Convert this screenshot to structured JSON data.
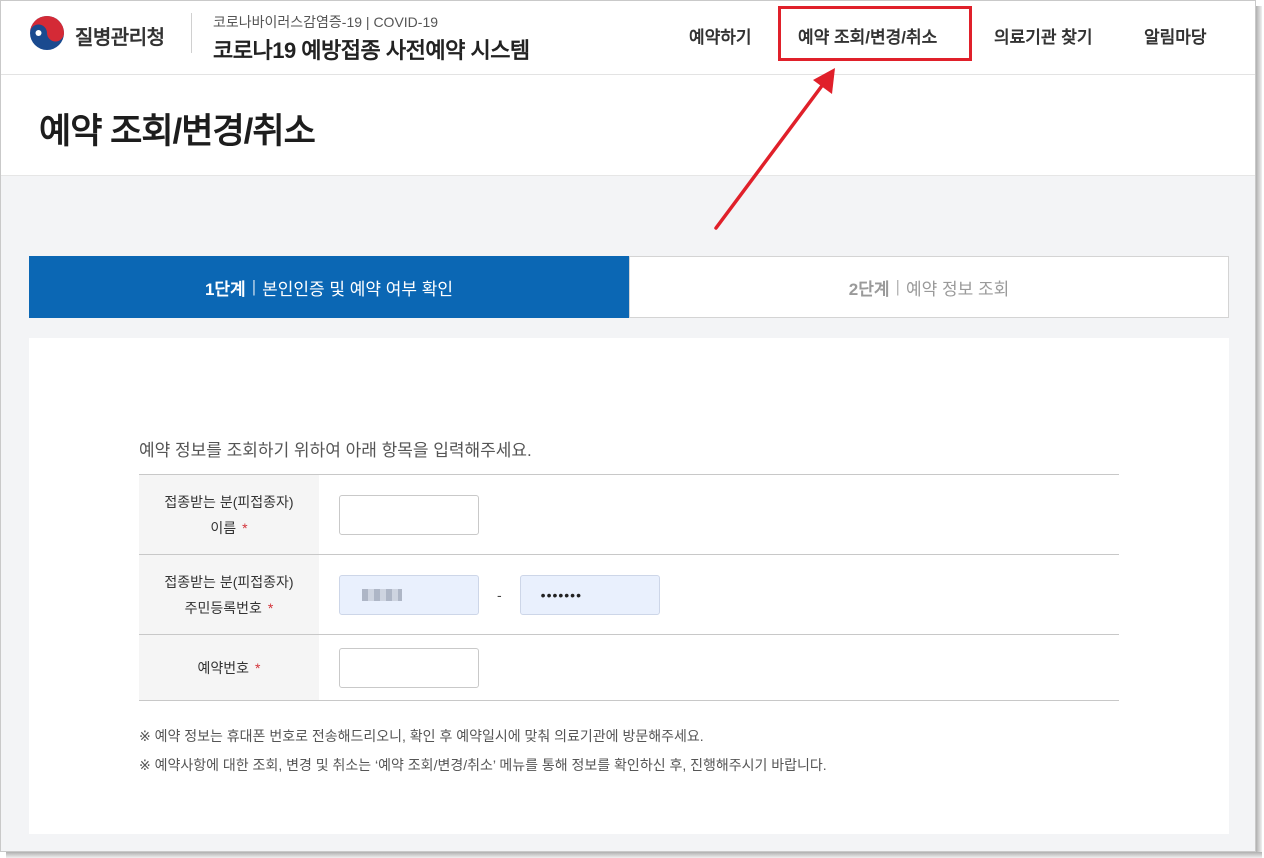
{
  "header": {
    "agency": "질병관리청",
    "subtitle": "코로나바이러스감염증-19 | COVID-19",
    "system_title": "코로나19 예방접종 사전예약 시스템",
    "nav": [
      "예약하기",
      "예약 조회/변경/취소",
      "의료기관 찾기",
      "알림마당"
    ]
  },
  "page": {
    "title": "예약 조회/변경/취소"
  },
  "steps": [
    {
      "number": "1단계",
      "label": "본인인증 및 예약 여부 확인",
      "active": true
    },
    {
      "number": "2단계",
      "label": "예약 정보 조회",
      "active": false
    }
  ],
  "form": {
    "intro": "예약 정보를 조회하기 위하여 아래 항목을 입력해주세요.",
    "fields": [
      {
        "label_line1": "접종받는 분(피접종자)",
        "label_line2": "이름",
        "required": "*",
        "value": ""
      },
      {
        "label_line1": "접종받는 분(피접종자)",
        "label_line2": "주민등록번호",
        "required": "*",
        "separator": "-",
        "value_masked": "•••••••"
      },
      {
        "label_line1": "예약번호",
        "required": "*",
        "value": ""
      }
    ]
  },
  "notes": [
    "※ 예약 정보는 휴대폰 번호로 전송해드리오니, 확인 후 예약일시에 맞춰 의료기관에 방문해주세요.",
    "※ 예약사항에 대한 조회, 변경 및 취소는 ‘예약 조회/변경/취소’ 메뉴를 통해 정보를 확인하신 후, 진행해주시기 바랍니다."
  ],
  "colors": {
    "primary": "#0b67b4",
    "highlight": "#e0202a",
    "required": "#d3333a"
  }
}
